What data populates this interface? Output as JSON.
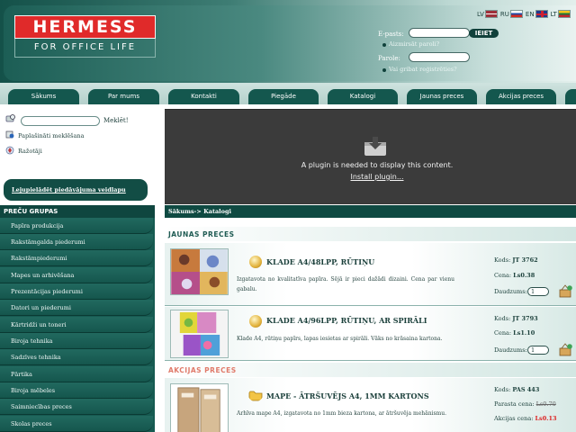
{
  "brand": {
    "name": "HERMESS",
    "tagline": "FOR OFFICE LIFE"
  },
  "languages": [
    {
      "code": "LV",
      "flag": "lv-flag"
    },
    {
      "code": "RU",
      "flag": "ru-flag"
    },
    {
      "code": "EN",
      "flag": "en-flag"
    },
    {
      "code": "LT",
      "flag": "lt-flag"
    }
  ],
  "login": {
    "email_label": "E-pasts:",
    "password_label": "Parole:",
    "submit": "IEIET",
    "forgot": "Aizmirsāt paroli?",
    "register": "Vai gribat reģistrēties?"
  },
  "nav": [
    "Sākums",
    "Par mums",
    "Kontakti",
    "Piegāde",
    "Katalogi",
    "Jaunas preces",
    "Akcijas preces"
  ],
  "sidebar": {
    "search_button": "Meklēt!",
    "advanced_search": "Paplašināti meklēšana",
    "manufacturers": "Ražotāji",
    "promo": "Lejupielādēt piedāvājuma veidlapu",
    "groups_title": "PREČU GRUPAS",
    "groups": [
      "Papīra produkcija",
      "Rakstāmgalda piederumi",
      "Rakstāmpiederumi",
      "Mapes un arhivēšana",
      "Prezentācijas piederumi",
      "Datori un piederumi",
      "Kārtridži un toneri",
      "Biroja tehnika",
      "Sadzīves tehnika",
      "Pārtika",
      "Biroja mēbeles",
      "Saimniecības preces",
      "Skolas preces"
    ]
  },
  "banner": {
    "message": "A plugin is needed to display this content.",
    "link": "Install plugin..."
  },
  "breadcrumb": "Sākums-> Katalogi",
  "sections": {
    "new": "JAUNAS PRECES",
    "sale": "AKCIJAS PRECES"
  },
  "labels": {
    "code": "Kods:",
    "price": "Cena:",
    "quantity": "Daudzums:",
    "regular_price": "Parasta cena:",
    "sale_price": "Akcijas cena:"
  },
  "products": [
    {
      "title": "KLADE A4/48LPP, RŪTIŅU",
      "desc": "Izgatavota no kvalitatīva papīra. Sējā ir pieci dažādi dizaini. Cena par vienu gabalu.",
      "code": "JT 3762",
      "price": "Ls0.38",
      "qty": "1"
    },
    {
      "title": "KLADE A4/96LPP, RŪTIŅU, AR SPIRĀLI",
      "desc": "Klade A4, rūtiņu papīrs, lapas iesietas ar spirāli. Vāks no krāsaina kartona.",
      "code": "JT 3793",
      "price": "Ls1.10",
      "qty": "1"
    },
    {
      "title": "MAPE - ĀTRŠUVĒJS A4, 1MM KARTONS",
      "desc": "Arhīva mape A4, izgatavota no 1mm bieza kartona, ar ātršuvēja mehānismu.",
      "code": "PAS 443",
      "regular_price": "Ls0.70",
      "sale_price": "Ls0.13"
    }
  ],
  "colors": {
    "brand_red": "#e02a2a",
    "dark_green": "#14574e",
    "sale_text": "#e07a6a"
  }
}
